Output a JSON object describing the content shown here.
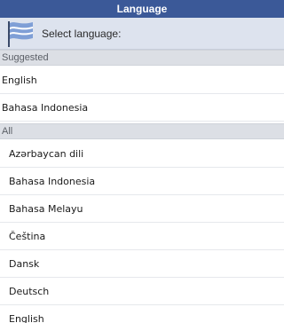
{
  "title": "Language",
  "prompt": {
    "label": "Select language:",
    "icon": "flag-icon"
  },
  "sections": {
    "suggested": {
      "header": "Suggested",
      "items": [
        "English",
        "Bahasa Indonesia"
      ]
    },
    "all": {
      "header": "All",
      "items": [
        "Azərbaycan dili",
        "Bahasa Indonesia",
        "Bahasa Melayu",
        "Čeština",
        "Dansk",
        "Deutsch",
        "English"
      ]
    }
  },
  "colors": {
    "titlebar": "#3b5998",
    "prompt_bg": "#dde3ee",
    "section_bg": "#dcdfe5"
  }
}
